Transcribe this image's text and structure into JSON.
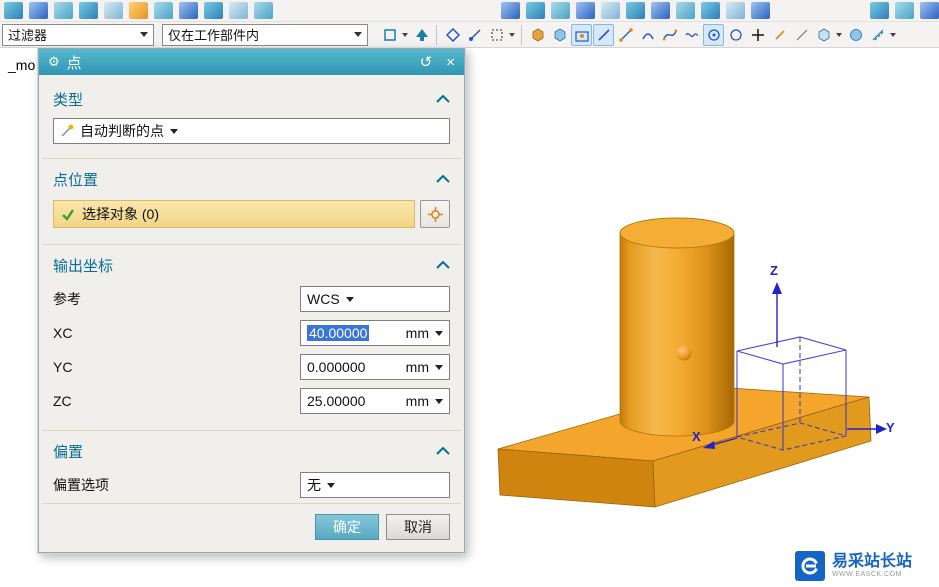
{
  "toolbars": {
    "filter_value": "过滤器",
    "scope_value": "仅在工作部件内"
  },
  "part_label": "_mo",
  "dialog": {
    "title": "点",
    "type_section": {
      "header": "类型",
      "value": "自动判断的点"
    },
    "location_section": {
      "header": "点位置",
      "select_text": "选择对象 (0)"
    },
    "coords_section": {
      "header": "输出坐标",
      "reference_label": "参考",
      "reference_value": "WCS",
      "xc_label": "XC",
      "xc_value": "40.00000",
      "yc_label": "YC",
      "yc_value": "0.000000",
      "zc_label": "ZC",
      "zc_value": "25.00000",
      "unit": "mm"
    },
    "offset_section": {
      "header": "偏置",
      "option_label": "偏置选项",
      "option_value": "无"
    },
    "ok": "确定",
    "cancel": "取消"
  },
  "viewport": {
    "x_label": "X",
    "y_label": "Y",
    "z_label": "Z"
  },
  "watermark": {
    "title": "易采站长站",
    "subtitle": "WWW.EASCK.COM"
  },
  "colors": {
    "accent_teal": "#2f96b2",
    "section_header": "#0a6d95",
    "highlight_yellow": "#f2d486",
    "selection_blue": "#3b74d8",
    "model_orange": "#f3a62b",
    "wcs_blue": "#3333cc",
    "watermark_blue": "#1565c4"
  }
}
